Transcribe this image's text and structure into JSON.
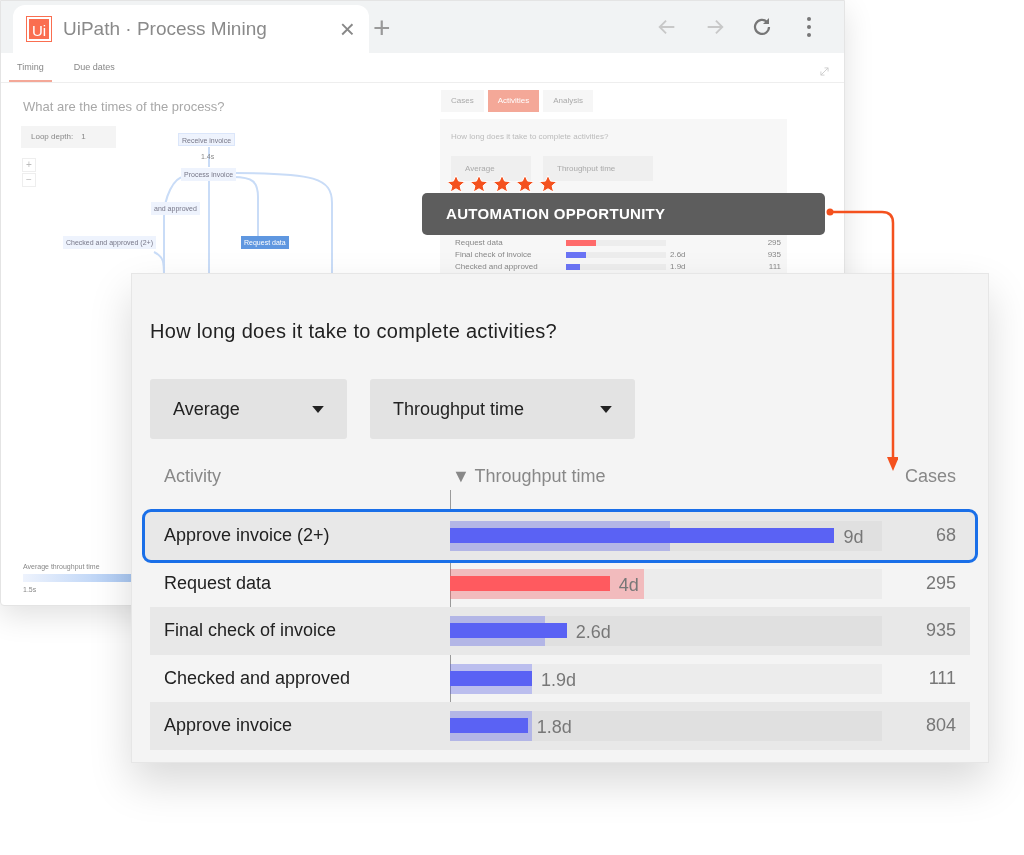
{
  "browser": {
    "logo": "Ui",
    "tab_title": "UiPath · Process Mining",
    "close": "×",
    "new_tab": "+"
  },
  "subtabs": [
    {
      "label": "Timing",
      "selected": true
    },
    {
      "label": "Due dates",
      "selected": false
    }
  ],
  "left": {
    "question": "What are the times of the process?",
    "loop_label": "Loop depth:",
    "loop_value": "1",
    "zoom_in": "+",
    "zoom_out": "−",
    "nodes": [
      {
        "label": "Receive invoice",
        "kind": "start"
      },
      {
        "label": "Process invoice",
        "kind": "plain"
      },
      {
        "label": "and approved",
        "kind": "plain"
      },
      {
        "label": "Checked and approved (2+)",
        "kind": "plain"
      },
      {
        "label": "Request data",
        "kind": "strong"
      }
    ],
    "edge_label": "1.4s",
    "legend": "Average throughput time",
    "legend_value": "1.5s"
  },
  "right": {
    "tabs": [
      {
        "label": "Cases",
        "selected": false
      },
      {
        "label": "Activities",
        "selected": true
      },
      {
        "label": "Analysis",
        "selected": false
      }
    ],
    "question": "How long does it take to complete activities?",
    "dropdowns": [
      "Average",
      "Throughput time"
    ],
    "rows": [
      {
        "activity": "Request data",
        "cases": "295",
        "level": 0.3,
        "color": "#ff6b6b"
      },
      {
        "activity": "Final check of invoice",
        "value": "2.6d",
        "cases": "935",
        "level": 0.2,
        "color": "#6b74f5"
      },
      {
        "activity": "Checked and approved",
        "value": "1.9d",
        "cases": "111",
        "level": 0.14,
        "color": "#6b74f5"
      }
    ]
  },
  "badge": {
    "stars": 5,
    "label": "AUTOMATION OPPORTUNITY"
  },
  "card": {
    "question": "How long does it take to complete activities?",
    "dropdowns": [
      "Average",
      "Throughput time"
    ],
    "columns": [
      "Activity",
      "▼ Throughput time",
      "Cases"
    ],
    "rows": [
      {
        "activity": "Approve invoice (2+)",
        "value": "9d",
        "cases": "68",
        "level": 0.89,
        "range": {
          "level": 0.51
        },
        "color": "#5a62f4",
        "highlighted": true
      },
      {
        "activity": "Request data",
        "value": "4d",
        "cases": "295",
        "level": 0.37,
        "range": {
          "level": 0.45
        },
        "color": "#ff5a5f",
        "highlighted": false
      },
      {
        "activity": "Final check of invoice",
        "value": "2.6d",
        "cases": "935",
        "level": 0.27,
        "range": {
          "level": 0.22
        },
        "color": "#5a62f4",
        "highlighted": false
      },
      {
        "activity": "Checked and approved",
        "value": "1.9d",
        "cases": "111",
        "level": 0.19,
        "range": {
          "level": 0.19
        },
        "color": "#5a62f4",
        "highlighted": false
      },
      {
        "activity": "Approve invoice",
        "value": "1.8d",
        "cases": "804",
        "level": 0.18,
        "range": {
          "level": 0.19
        },
        "color": "#5a62f4",
        "highlighted": false
      }
    ]
  }
}
